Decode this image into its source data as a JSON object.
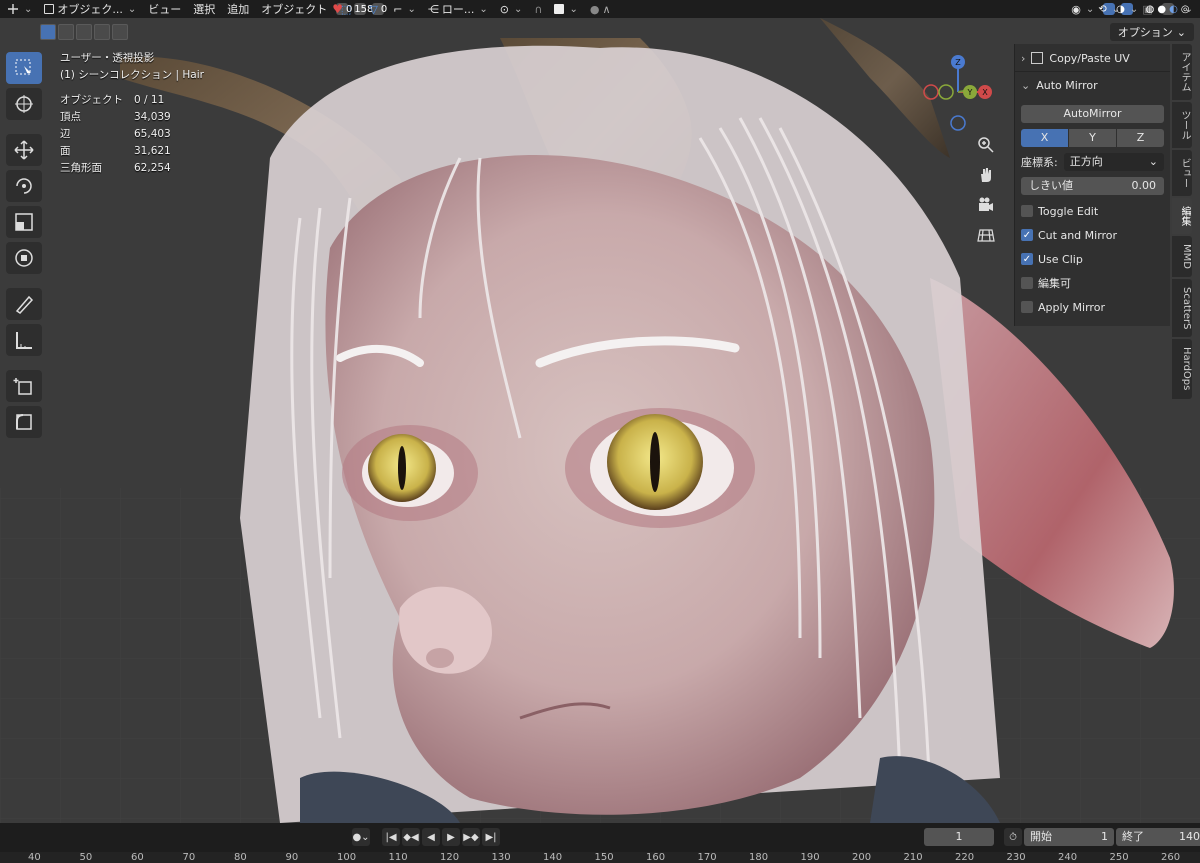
{
  "header": {
    "mode_label": "オブジェク...",
    "menu": [
      "ビュー",
      "選択",
      "追加",
      "オブジェクト"
    ],
    "stat_a": "0",
    "stat_b": "1583",
    "stat_c": "0",
    "overlay_label": "ロー..."
  },
  "viewport": {
    "options_label": "オプション",
    "view_title": "ユーザー・透視投影",
    "collection": "(1) シーンコレクション | Hair",
    "stats": [
      {
        "label": "オブジェクト",
        "value": "0 / 11"
      },
      {
        "label": "頂点",
        "value": "34,039"
      },
      {
        "label": "辺",
        "value": "65,403"
      },
      {
        "label": "面",
        "value": "31,621"
      },
      {
        "label": "三角形面",
        "value": "62,254"
      }
    ]
  },
  "npanel": {
    "copy_paste_title": "Copy/Paste UV",
    "auto_mirror_title": "Auto Mirror",
    "auto_mirror_button": "AutoMirror",
    "axes": [
      "X",
      "Y",
      "Z"
    ],
    "coord_label": "座標系:",
    "coord_value": "正方向",
    "threshold_label": "しきい値",
    "threshold_value": "0.00",
    "checks": [
      {
        "label": "Toggle Edit",
        "checked": false
      },
      {
        "label": "Cut and Mirror",
        "checked": true
      },
      {
        "label": "Use Clip",
        "checked": true
      },
      {
        "label": "編集可",
        "checked": false
      },
      {
        "label": "Apply Mirror",
        "checked": false
      }
    ]
  },
  "tabs": [
    "アイテム",
    "ツール",
    "ビュー",
    "編集",
    "MMD",
    "ScatterS",
    "HardOps"
  ],
  "timeline": {
    "current_frame": "1",
    "start_label": "開始",
    "start_value": "1",
    "end_label": "終了",
    "end_value": "140",
    "ruler": [
      "40",
      "50",
      "60",
      "70",
      "80",
      "90",
      "100",
      "110",
      "120",
      "130",
      "140",
      "150",
      "160",
      "170",
      "180",
      "190",
      "200",
      "210",
      "220",
      "230",
      "240",
      "250",
      "260"
    ]
  },
  "colors": {
    "accent": "#4772b3",
    "header_bg": "#1d1d1d",
    "panel_bg": "#303030"
  }
}
